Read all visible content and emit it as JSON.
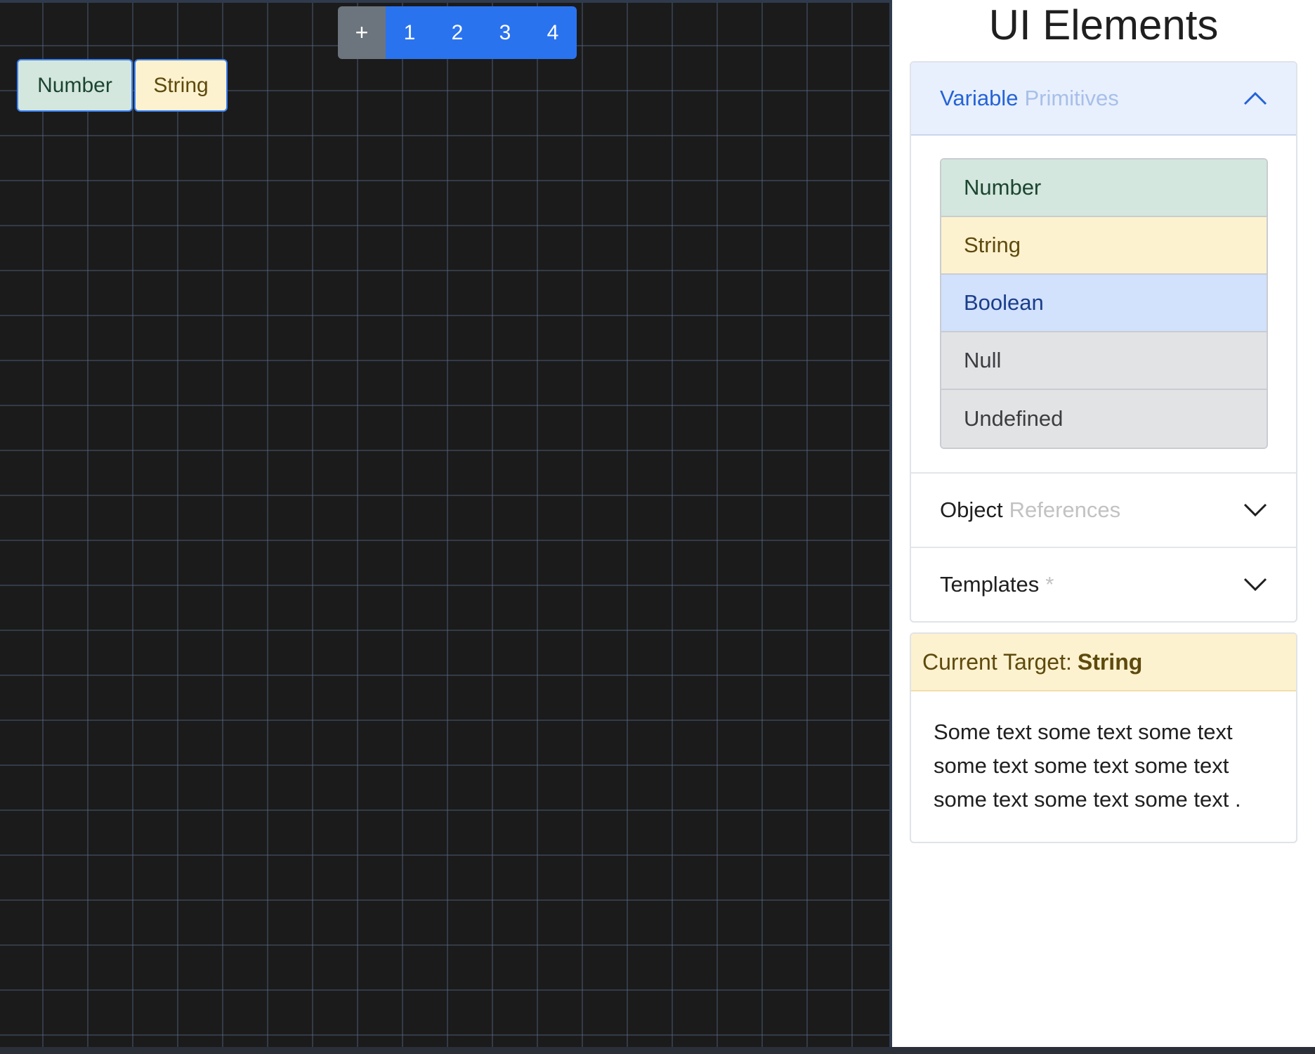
{
  "canvas": {
    "page_bar": {
      "add_label": "+",
      "pages": [
        "1",
        "2",
        "3",
        "4"
      ]
    },
    "nodes": {
      "number": "Number",
      "string": "String"
    }
  },
  "panel": {
    "title": "UI Elements",
    "sections": {
      "variable": {
        "title": "Variable",
        "subtitle": "Primitives",
        "expanded": true,
        "items": [
          "Number",
          "String",
          "Boolean",
          "Null",
          "Undefined"
        ]
      },
      "object": {
        "title": "Object",
        "subtitle": "References",
        "expanded": false
      },
      "templates": {
        "title": "Templates",
        "subtitle": "*",
        "expanded": false
      }
    },
    "target_card": {
      "label": "Current Target:",
      "value": "String",
      "body": "Some text some text some text some text some text some text some text some text some text ."
    }
  },
  "colors": {
    "accent": "#2a73ee",
    "number_bg": "#d3e7de",
    "string_bg": "#fdf2cf",
    "boolean_bg": "#d2e1fc",
    "null_bg": "#e2e3e5",
    "canvas_bg": "#1b1b1c"
  }
}
